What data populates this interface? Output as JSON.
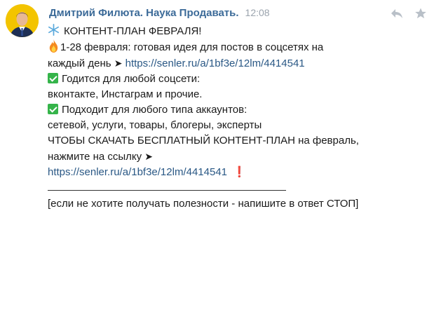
{
  "message": {
    "sender": "Дмитрий Филюта. Наука Продавать.",
    "time": "12:08",
    "icons": {
      "reply": "reply-icon",
      "star": "star-icon",
      "snowflake": "snowflake-icon",
      "fire": "fire-icon",
      "check": "check-mark-icon"
    },
    "title": "КОНТЕНТ-ПЛАН ФЕВРАЛЯ!",
    "p1_text": "1-28 февраля: готовая идея для постов в соцсетях на",
    "p1_text2": "каждый день",
    "p1_arrow": "➤",
    "p1_link": "https://senler.ru/a/1bf3e/12lm/4414541",
    "p2_line1": "Годится для любой соцсети:",
    "p2_line2": "вконтакте, Инстаграм и прочие.",
    "p3_line1": "Подходит для любого типа аккаунтов:",
    "p3_line2": "сетевой, услуги, товары, блогеры, эксперты",
    "p4_line1": "ЧТОБЫ СКАЧАТЬ БЕСПЛАТНЫЙ КОНТЕНТ-ПЛАН на февраль,",
    "p4_line2": "нажмите на ссылку",
    "p4_arrow": "➤",
    "p4_link": "https://senler.ru/a/1bf3e/12lm/4414541",
    "p4_mark": "❗",
    "unsubscribe": "[если не хотите получать полезности - напишите в ответ СТОП]"
  },
  "colors": {
    "sender": "#3b6a98",
    "link": "#2a5885",
    "check": "#35b44a",
    "avatar_bg": "#f3c400"
  }
}
